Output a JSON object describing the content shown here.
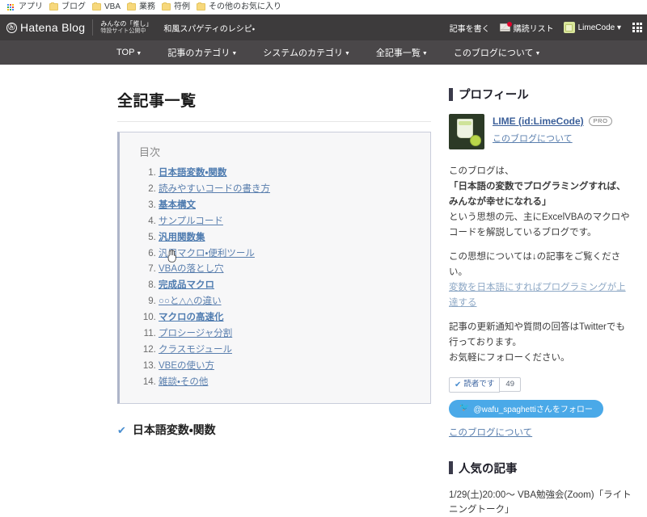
{
  "browser": {
    "bookmarks": [
      {
        "icon": "apps-grid-icon",
        "label": "アプリ"
      },
      {
        "icon": "folder-icon",
        "label": "ブログ"
      },
      {
        "icon": "folder-icon",
        "label": "VBA"
      },
      {
        "icon": "folder-icon",
        "label": "業務"
      },
      {
        "icon": "folder-icon",
        "label": "符例"
      },
      {
        "icon": "folder-icon",
        "label": "その他のお気に入り"
      }
    ]
  },
  "global_header": {
    "logo_text": "Hatena Blog",
    "promo_line1": "みんなの「推し」",
    "promo_line2": "特設サイト公開中",
    "campaign": "和風スパゲティのレシピ・",
    "write_label": "記事を書く",
    "subscribe_label": "購読リスト",
    "user_label": "LimeCode ▾",
    "bg_color": "#3d3b3c"
  },
  "blog_nav": {
    "items": [
      {
        "label": "TOP"
      },
      {
        "label": "記事のカテゴリ"
      },
      {
        "label": "システムのカテゴリ"
      },
      {
        "label": "全記事一覧"
      },
      {
        "label": "このブログについて"
      }
    ],
    "bg_color": "#4a4749"
  },
  "main": {
    "page_title": "全記事一覧",
    "toc": {
      "title": "目次",
      "items": [
        {
          "n": 1,
          "label": "日本語変数・関数",
          "bold": true
        },
        {
          "n": 2,
          "label": "読みやすいコードの書き方",
          "bold": false
        },
        {
          "n": 3,
          "label": "基本構文",
          "bold": true
        },
        {
          "n": 4,
          "label": "サンプルコード",
          "bold": false
        },
        {
          "n": 5,
          "label": "汎用関数集",
          "bold": true
        },
        {
          "n": 6,
          "label": "汎用マクロ・便利ツール",
          "bold": false
        },
        {
          "n": 7,
          "label": "VBAの落とし穴",
          "bold": false
        },
        {
          "n": 8,
          "label": "完成品マクロ",
          "bold": true
        },
        {
          "n": 9,
          "label": "○○と△△の違い",
          "bold": false
        },
        {
          "n": 10,
          "label": "マクロの高速化",
          "bold": true
        },
        {
          "n": 11,
          "label": "プロシージャ分割",
          "bold": false
        },
        {
          "n": 12,
          "label": "クラスモジュール",
          "bold": false
        },
        {
          "n": 13,
          "label": "VBEの使い方",
          "bold": false
        },
        {
          "n": 14,
          "label": "雑談・その他",
          "bold": false
        }
      ],
      "border_color": "#c9cddb",
      "bg_color": "#f7f7f8"
    },
    "first_section_heading": "日本語変数・関数"
  },
  "sidebar": {
    "profile": {
      "title": "プロフィール",
      "name": "LIME (id:LimeCode)",
      "pro_badge": "PRO",
      "about_link": "このブログについて",
      "desc_line1": "このブログは、",
      "desc_quote": "「日本語の変数でプログラミングすれば、みんなが幸せになれる」",
      "desc_line2": "という思想の元、主にExcelVBAのマクロやコードを解説しているブログです。",
      "desc_line3": "この思想については↓の記事をご覧ください。",
      "desc_link": "変数を日本語にすればプログラミングが上達する",
      "desc_line4": "記事の更新通知や質問の回答はTwitterでも行っております。",
      "desc_line5": "お気軽にフォローください。",
      "reader_button": "読者です",
      "reader_count": "49",
      "twitter_button": "@wafu_spaghettiさんをフォロー",
      "bottom_link": "このブログについて"
    },
    "popular": {
      "title": "人気の記事",
      "items": [
        "1/29(土)20:00〜 VBA勉強会(Zoom)「ライトニングトーク」"
      ]
    }
  }
}
